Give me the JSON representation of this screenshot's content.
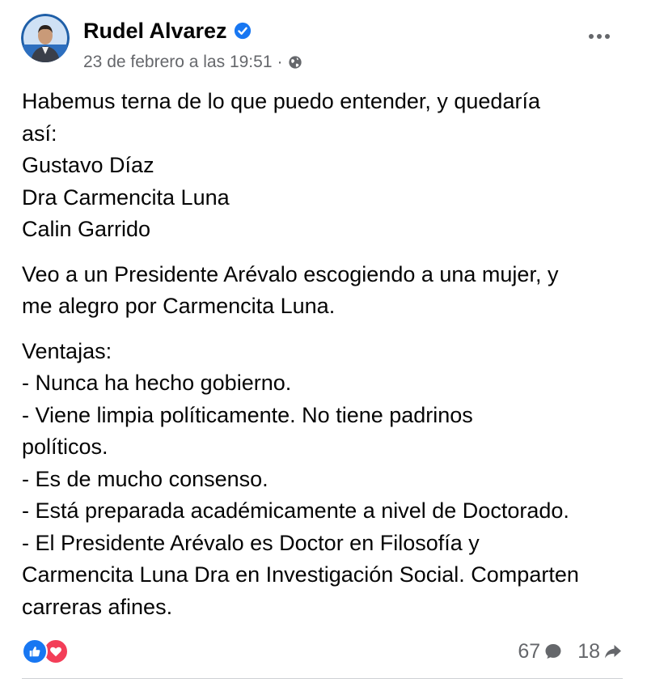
{
  "post": {
    "author": {
      "name": "Rudel Alvarez",
      "verified": true
    },
    "timestamp": "23 de febrero a las 19:51",
    "separator": "·",
    "audience_icon": "globe-icon",
    "more_icon": "more-options-icon",
    "paragraphs": [
      [
        "Habemus terna de lo que puedo entender, y quedaría",
        "así:",
        "Gustavo Díaz",
        "Dra Carmencita Luna",
        "Calin Garrido"
      ],
      [
        "Veo a un Presidente Arévalo escogiendo a una mujer, y",
        "me alegro por Carmencita Luna."
      ],
      [
        "Ventajas:",
        "- Nunca ha hecho gobierno.",
        "- Viene limpia políticamente. No tiene padrinos",
        "políticos.",
        "- Es de mucho consenso.",
        "- Está preparada académicamente a nivel de Doctorado.",
        "- El Presidente Arévalo es Doctor en Filosofía y",
        "Carmencita Luna Dra en Investigación Social. Comparten",
        "carreras afines."
      ]
    ],
    "reactions": [
      "like-icon",
      "love-icon"
    ],
    "comments_count": "67",
    "shares_count": "18"
  },
  "colors": {
    "facebook_blue": "#1877f2",
    "love_red": "#f33e58",
    "secondary_text": "#65676b",
    "primary_text": "#050505"
  }
}
